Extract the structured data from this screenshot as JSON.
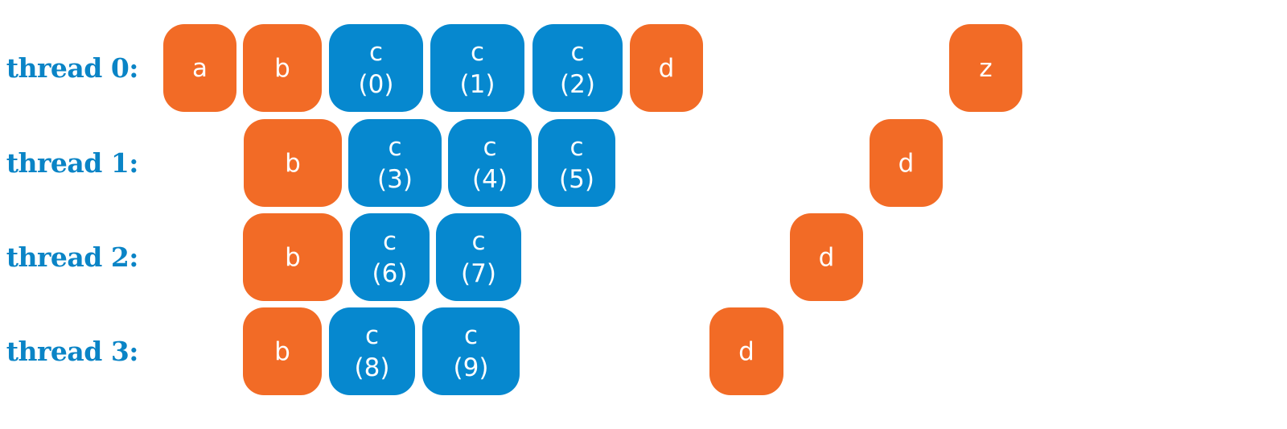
{
  "colors": {
    "label": "#0a84c6",
    "orange": "#f26b26",
    "blue": "#0688cf"
  },
  "threads": [
    {
      "label": "thread 0:",
      "tasks": [
        {
          "name": "a",
          "index": "",
          "kind": "orange"
        },
        {
          "name": "b",
          "index": "",
          "kind": "orange"
        },
        {
          "name": "c",
          "index": "(0)",
          "kind": "blue"
        },
        {
          "name": "c",
          "index": "(1)",
          "kind": "blue"
        },
        {
          "name": "c",
          "index": "(2)",
          "kind": "blue"
        },
        {
          "name": "d",
          "index": "",
          "kind": "orange"
        },
        {
          "name": "z",
          "index": "",
          "kind": "orange"
        }
      ]
    },
    {
      "label": "thread 1:",
      "tasks": [
        {
          "name": "b",
          "index": "",
          "kind": "orange"
        },
        {
          "name": "c",
          "index": "(3)",
          "kind": "blue"
        },
        {
          "name": "c",
          "index": "(4)",
          "kind": "blue"
        },
        {
          "name": "c",
          "index": "(5)",
          "kind": "blue"
        },
        {
          "name": "d",
          "index": "",
          "kind": "orange"
        }
      ]
    },
    {
      "label": "thread 2:",
      "tasks": [
        {
          "name": "b",
          "index": "",
          "kind": "orange"
        },
        {
          "name": "c",
          "index": "(6)",
          "kind": "blue"
        },
        {
          "name": "c",
          "index": "(7)",
          "kind": "blue"
        },
        {
          "name": "d",
          "index": "",
          "kind": "orange"
        }
      ]
    },
    {
      "label": "thread 3:",
      "tasks": [
        {
          "name": "b",
          "index": "",
          "kind": "orange"
        },
        {
          "name": "c",
          "index": "(8)",
          "kind": "blue"
        },
        {
          "name": "c",
          "index": "(9)",
          "kind": "blue"
        },
        {
          "name": "d",
          "index": "",
          "kind": "orange"
        }
      ]
    }
  ]
}
